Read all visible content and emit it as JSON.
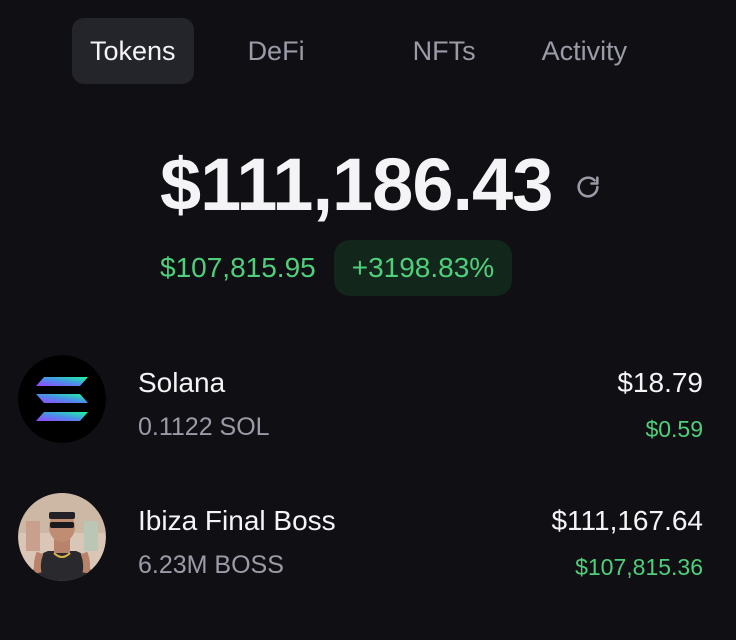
{
  "tabs": [
    {
      "label": "Tokens",
      "active": true
    },
    {
      "label": "DeFi",
      "active": false
    },
    {
      "label": "NFTs",
      "active": false
    },
    {
      "label": "Activity",
      "active": false
    }
  ],
  "portfolio": {
    "balance": "$111,186.43",
    "refresh_icon": "refresh-icon",
    "change_amount": "$107,815.95",
    "change_percent": "+3198.83%"
  },
  "tokens": [
    {
      "name": "Solana",
      "amount": "0.1122 SOL",
      "value": "$18.79",
      "change": "$0.59",
      "icon": "solana-logo-icon"
    },
    {
      "name": "Ibiza Final Boss",
      "amount": "6.23M BOSS",
      "value": "$111,167.64",
      "change": "$107,815.36",
      "icon": "boss-avatar-icon"
    }
  ],
  "colors": {
    "background": "#101014",
    "positive": "#4fcf7b",
    "muted": "#9b9ba8",
    "active_tab_bg": "#24242b"
  }
}
